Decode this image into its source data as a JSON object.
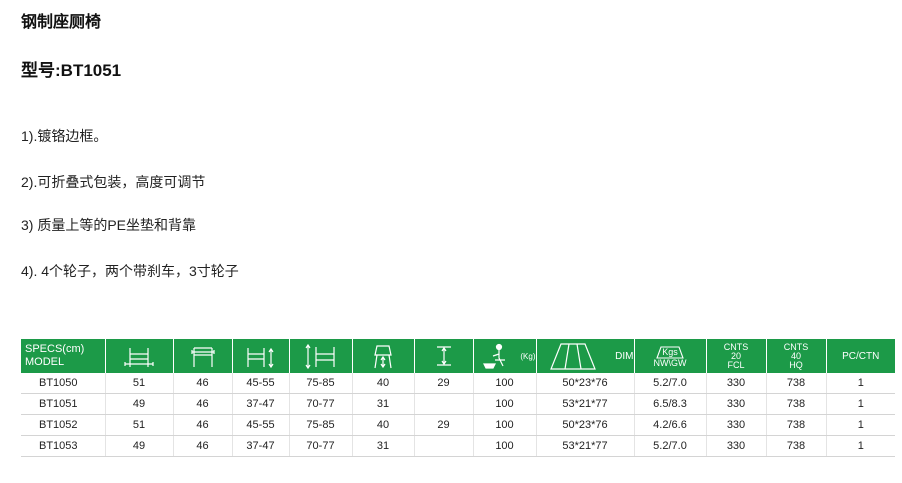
{
  "title": "钢制座厕椅",
  "model_line": "型号:BT1051",
  "features": [
    "1).镀铬边框。",
    "2).可折叠式包装，高度可调节",
    "3) 质量上等的PE坐垫和背靠",
    "4). 4个轮子，两个带刹车，3寸轮子"
  ],
  "table": {
    "header": {
      "specs_top": "SPECS(cm)",
      "specs_bottom": "MODEL",
      "icons": [
        "chair-width-icon",
        "seat-width-icon",
        "seat-height-adjust-icon",
        "total-height-icon",
        "seat-depth-icon",
        "seat-height-icon",
        "max-load-icon",
        "carton-dimension-icon",
        "weight-icon"
      ],
      "kg_label": "(Kg)",
      "dim_label": "DIM",
      "kgs_label": "Kgs",
      "nwgw_label": "NW\\GW",
      "cnts20": [
        "CNTS",
        "20",
        "FCL"
      ],
      "cnts40": [
        "CNTS",
        "40",
        "HQ"
      ],
      "pcctn": "PC/CTN"
    },
    "rows": [
      [
        "BT1050",
        "51",
        "46",
        "45-55",
        "75-85",
        "40",
        "29",
        "100",
        "50*23*76",
        "5.2/7.0",
        "330",
        "738",
        "1"
      ],
      [
        "BT1051",
        "49",
        "46",
        "37-47",
        "70-77",
        "31",
        "",
        "100",
        "53*21*77",
        "6.5/8.3",
        "330",
        "738",
        "1"
      ],
      [
        "BT1052",
        "51",
        "46",
        "45-55",
        "75-85",
        "40",
        "29",
        "100",
        "50*23*76",
        "4.2/6.6",
        "330",
        "738",
        "1"
      ],
      [
        "BT1053",
        "49",
        "46",
        "37-47",
        "70-77",
        "31",
        "",
        "100",
        "53*21*77",
        "5.2/7.0",
        "330",
        "738",
        "1"
      ]
    ]
  }
}
